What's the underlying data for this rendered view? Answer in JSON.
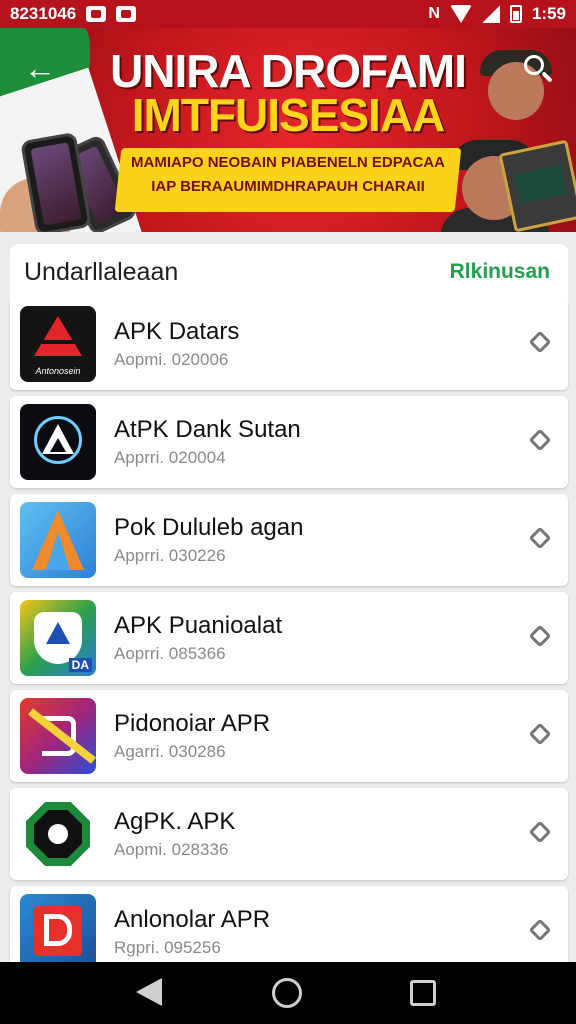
{
  "status_bar": {
    "left_text": "8231046",
    "time": "1:59",
    "icons": [
      "image-icon",
      "notification-icon",
      "mute-icon",
      "wifi-icon",
      "signal-icon",
      "battery-icon"
    ]
  },
  "banner": {
    "title": "UNIRA DROFAMI",
    "subtitle": "IMTFUISESIAA",
    "ribbon_line1": "MAMIAPO NEOBAIN PIABENELN EDPACAA",
    "ribbon_line2": "IAP BERAAUMIMDHRAPAUH CHARAII",
    "colors": {
      "background": "#c0161c",
      "title": "#ffffff",
      "subtitle": "#ffd51a",
      "ribbon": "#fbd21a"
    }
  },
  "section": {
    "title": "Undarllaleaan",
    "link": "Rlkinusan",
    "link_color": "#22a04b"
  },
  "apps": [
    {
      "name": "APK Datars",
      "version": "Aopmi. 020006",
      "icon": "red-triangle-icon",
      "icon_label": "Antonosein"
    },
    {
      "name": "AtPK Dank Sutan",
      "version": "Apprri. 020004",
      "icon": "blue-ring-triangle-icon"
    },
    {
      "name": "Pok Dululeb agan",
      "version": "Apprri. 030226",
      "icon": "orange-a-icon"
    },
    {
      "name": "APK Puanioalat",
      "version": "Aoprri. 085366",
      "icon": "shield-triangle-icon",
      "icon_label": "DA"
    },
    {
      "name": "Pidonoiar APR",
      "version": "Agarri. 030286",
      "icon": "gradient-d-icon"
    },
    {
      "name": "AgPK. APK",
      "version": "Aopmi. 028336",
      "icon": "green-octagon-eye-icon"
    },
    {
      "name": "Anlonolar APR",
      "version": "Rgpri. 095256",
      "icon": "red-d-box-icon"
    }
  ]
}
